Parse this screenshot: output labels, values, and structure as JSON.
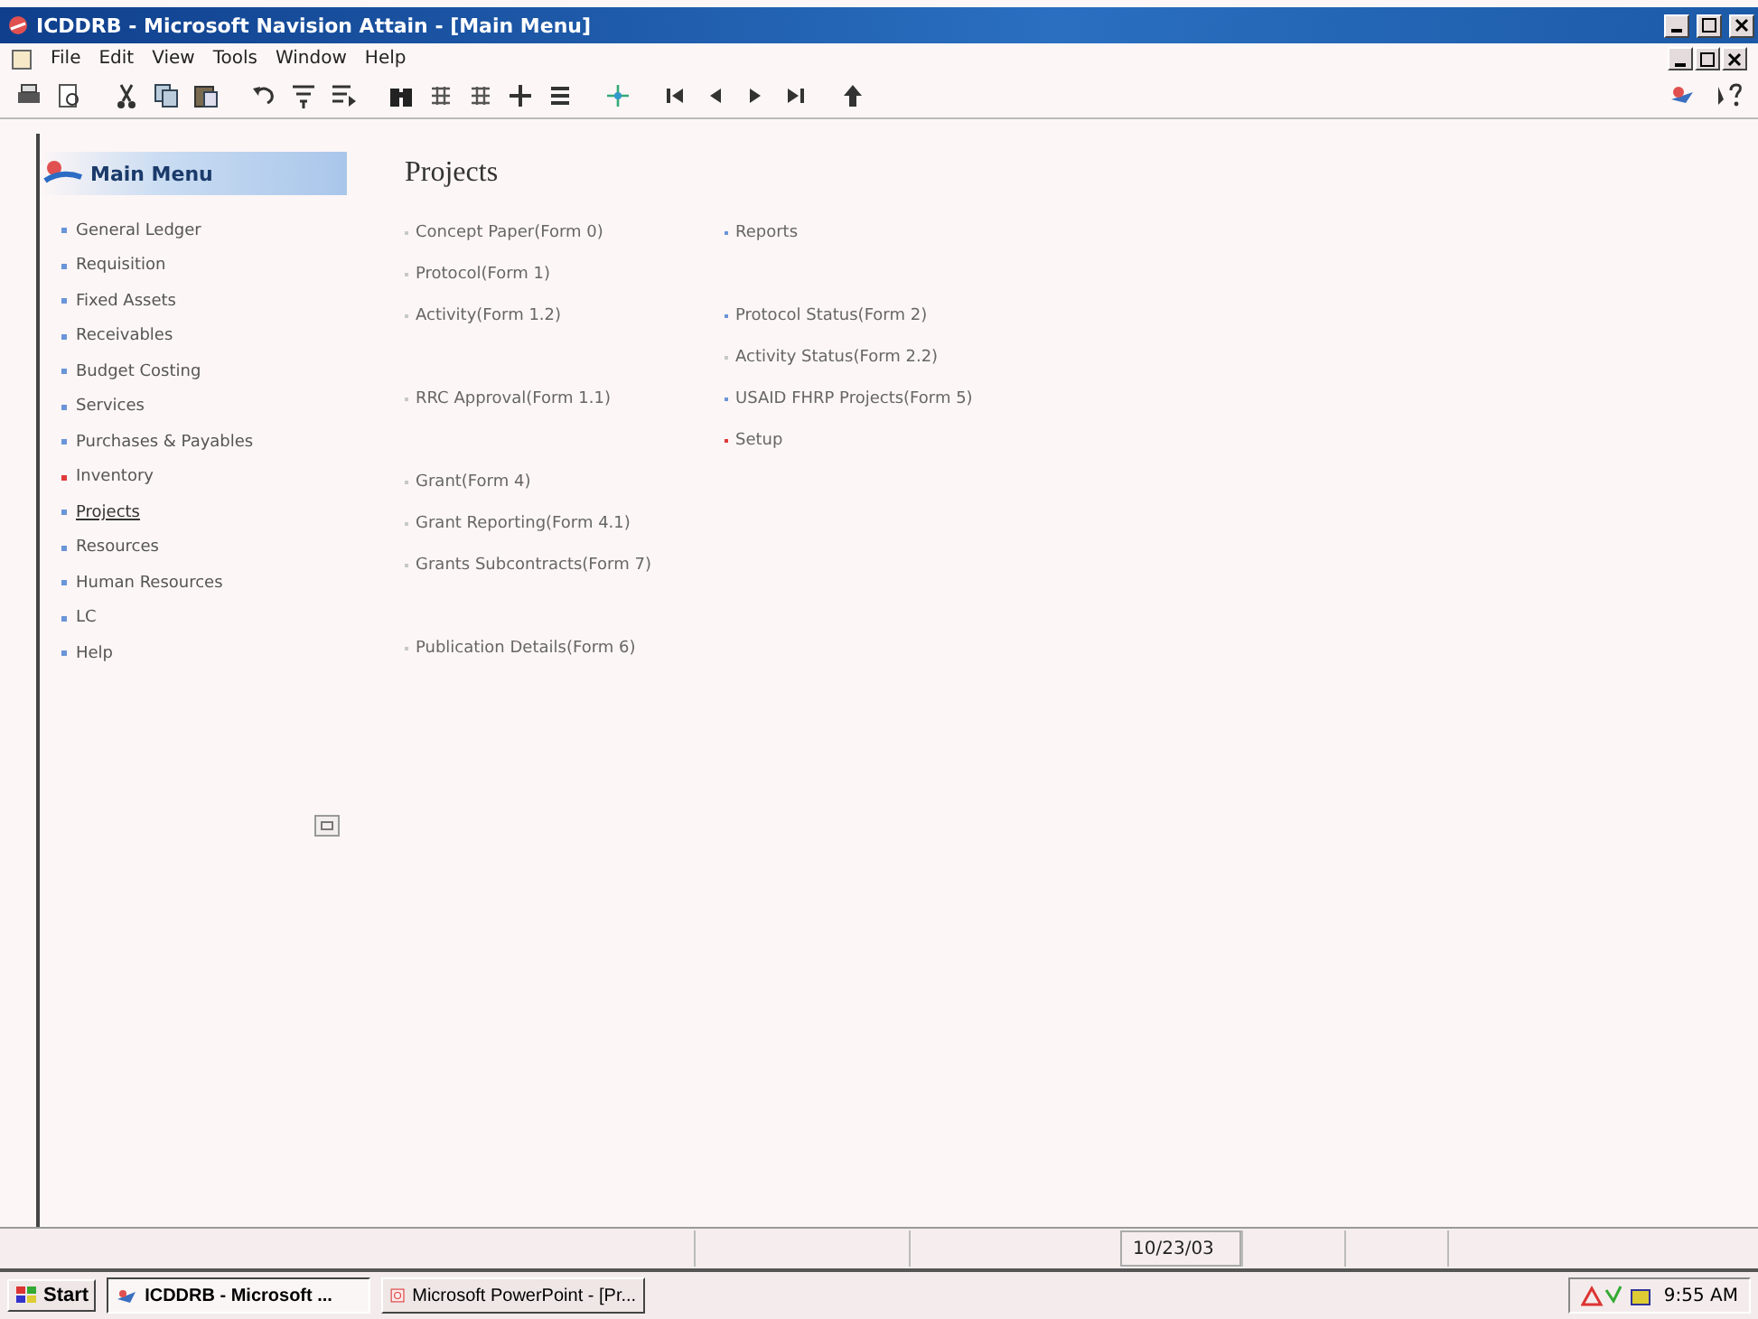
{
  "window": {
    "title": "ICDDRB - Microsoft Navision Attain - [Main Menu]"
  },
  "menu_bar": [
    "File",
    "Edit",
    "View",
    "Tools",
    "Window",
    "Help"
  ],
  "sidebar": {
    "title": "Main Menu",
    "items": [
      {
        "label": "General Ledger",
        "selected": false,
        "color": "#6a95d8"
      },
      {
        "label": "Requisition",
        "selected": false,
        "color": "#6a95d8"
      },
      {
        "label": "Fixed Assets",
        "selected": false,
        "color": "#6a95d8"
      },
      {
        "label": "Receivables",
        "selected": false,
        "color": "#6a95d8"
      },
      {
        "label": "Budget Costing",
        "selected": false,
        "color": "#6a95d8"
      },
      {
        "label": "Services",
        "selected": false,
        "color": "#6a95d8"
      },
      {
        "label": "Purchases & Payables",
        "selected": false,
        "color": "#6a95d8"
      },
      {
        "label": "Inventory",
        "selected": false,
        "color": "#e03a3a"
      },
      {
        "label": "Projects",
        "selected": true,
        "color": "#6a95d8"
      },
      {
        "label": "Resources",
        "selected": false,
        "color": "#6a95d8"
      },
      {
        "label": "Human Resources",
        "selected": false,
        "color": "#6a95d8"
      },
      {
        "label": "LC",
        "selected": false,
        "color": "#6a95d8"
      },
      {
        "label": "Help",
        "selected": false,
        "color": "#6a95d8"
      }
    ]
  },
  "content": {
    "title": "Projects",
    "rows": [
      {
        "kind": "row",
        "left": {
          "label": "Concept Paper(Form 0)",
          "color": "#c8c8c8"
        },
        "right": {
          "label": "Reports",
          "color": "#6a95d8"
        }
      },
      {
        "kind": "row",
        "left": {
          "label": "Protocol(Form 1)",
          "color": "#c8c8c8"
        }
      },
      {
        "kind": "row",
        "left": {
          "label": "Activity(Form 1.2)",
          "color": "#c8c8c8"
        },
        "right": {
          "label": "Protocol Status(Form 2)",
          "color": "#6a95d8"
        }
      },
      {
        "kind": "row",
        "right": {
          "label": "Activity Status(Form 2.2)",
          "color": "#c8c8c8"
        }
      },
      {
        "kind": "row",
        "left": {
          "label": "RRC Approval(Form 1.1)",
          "color": "#c8c8c8"
        },
        "right": {
          "label": "USAID FHRP Projects(Form 5)",
          "color": "#6a95d8"
        }
      },
      {
        "kind": "row",
        "right": {
          "label": "Setup",
          "color": "#e03a3a"
        }
      },
      {
        "kind": "row",
        "left": {
          "label": "Grant(Form 4)",
          "color": "#c8c8c8"
        }
      },
      {
        "kind": "row",
        "left": {
          "label": "Grant Reporting(Form 4.1)",
          "color": "#c8c8c8"
        }
      },
      {
        "kind": "row",
        "left": {
          "label": "Grants Subcontracts(Form 7)",
          "color": "#c8c8c8"
        }
      },
      {
        "kind": "blank"
      },
      {
        "kind": "row",
        "left": {
          "label": "Publication Details(Form 6)",
          "color": "#c8c8c8"
        }
      }
    ]
  },
  "status_bar": {
    "date": "10/23/03"
  },
  "taskbar": {
    "start": "Start",
    "tasks": [
      {
        "label": "ICDDRB - Microsoft ...",
        "selected": true,
        "kind": "navision"
      },
      {
        "label": "Microsoft PowerPoint - [Pr...",
        "selected": false,
        "kind": "powerpoint"
      }
    ],
    "clock": "9:55 AM"
  }
}
